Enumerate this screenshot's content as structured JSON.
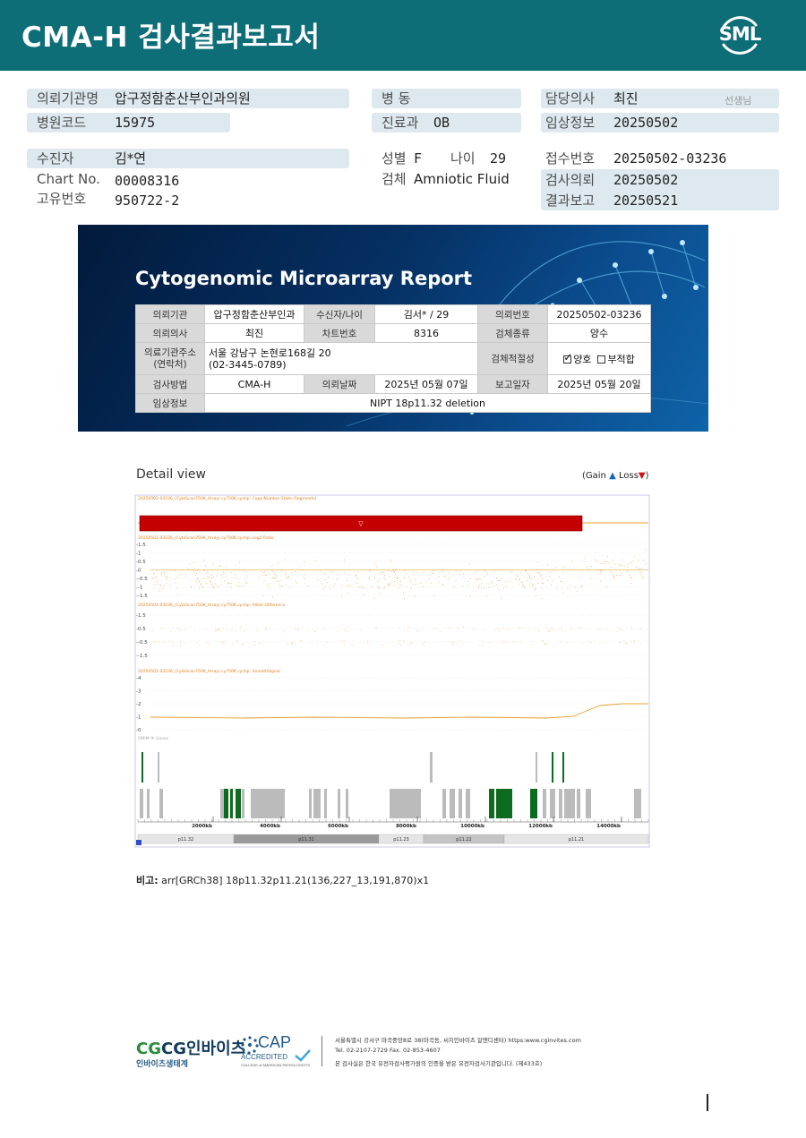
{
  "header": {
    "title": "CMA-H 검사결과보고서",
    "logo_text": "SML"
  },
  "info": {
    "institution_label": "의뢰기관명",
    "institution": "압구정함춘산부인과의원",
    "hospital_code_label": "병원코드",
    "hospital_code": "15975",
    "patient_label": "수진자",
    "patient": "김*연",
    "chart_no_label": "Chart No.",
    "chart_no": "00008316",
    "unique_no_label": "고유번호",
    "unique_no": "950722-2",
    "ward_label": "병 동",
    "dept_label": "진료과",
    "dept": "OB",
    "sex_label": "성별",
    "sex": "F",
    "age_label": "나이",
    "age": "29",
    "specimen_label": "검체",
    "specimen": "Amniotic Fluid",
    "doctor_label": "담당의사",
    "doctor": "최진",
    "doctor_suffix": "선생님",
    "clinical_label": "임상정보",
    "clinical": "20250502",
    "receipt_label": "접수번호",
    "receipt": "20250502-03236",
    "request_label": "검사의뢰",
    "request": "20250502",
    "report_label": "결과보고",
    "report": "20250521"
  },
  "banner": {
    "title": "Cytogenomic Microarray Report",
    "table": {
      "inst_label": "의뢰기관",
      "inst": "압구정함춘산부인과",
      "recipient_label": "수신자/나이",
      "recipient": "김서* / 29",
      "req_no_label": "의뢰번호",
      "req_no": "20250502-03236",
      "doctor_label": "의뢰의사",
      "doctor": "최진",
      "chart_label": "차트번호",
      "chart": "8316",
      "spec_label": "검체종류",
      "spec": "양수",
      "addr_label_1": "의료기관주소",
      "addr_label_2": "(연락처)",
      "addr_1": "서울 강남구 논현로168길 20",
      "addr_2": "(02-3445-0789)",
      "adequacy_label": "검체적절성",
      "adequate": "양호",
      "inadequate": "부적합",
      "method_label": "검사방법",
      "method": "CMA-H",
      "req_date_label": "의뢰날짜",
      "req_date": "2025년 05월 07일",
      "report_date_label": "보고일자",
      "report_date": "2025년 05월 20일",
      "clinical_label": "임상정보",
      "clinical": "NIPT 18p11.32 deletion"
    }
  },
  "detail": {
    "title": "Detail view",
    "legend_prefix": "(Gain",
    "legend_gain_icon": "▲",
    "legend_mid": "Loss",
    "legend_loss_icon": "▼",
    "legend_suffix": ")",
    "track_cn": "20250502-03236_(CytoScan750K_Array).cy750K.cychp: Copy Number State (Segments)",
    "track_log2": "20250502-03236_(CytoScan750K_Array).cy750K.cychp: Log2 Ratio",
    "track_allele": "20250502-03236_(CytoScan750K_Array).cy750K.cychp: Allele Difference",
    "track_smooth": "20250502-03236_(CytoScan750K_Array).cy750K.cychp: SmoothSignal",
    "track_omim": "OMIM ® Genes",
    "log2_ticks": [
      "1.5",
      "1",
      "0.5",
      "0",
      "-0.5",
      "-1",
      "-1.5"
    ],
    "allele_ticks": [
      "1.5",
      "0.5",
      "-0.5",
      "-1.5"
    ],
    "smooth_ticks": [
      "4",
      "3",
      "2",
      "1",
      "0"
    ],
    "axis_ticks": [
      "2000kb",
      "4000kb",
      "6000kb",
      "8000kb",
      "10000kb",
      "12000kb",
      "14000kb"
    ],
    "bands": [
      "p11.32",
      "p11.31",
      "p11.23",
      "p11.22",
      "p11.21"
    ],
    "loss_glyph": "▽",
    "remark_label": "비고:",
    "remark": "arr[GRCh38] 18p11.32p11.21(136,227_13,191,870)x1"
  },
  "footer": {
    "logo_main": "CG인바이츠",
    "logo_sub": "인바이츠생태계",
    "cap": "CAP",
    "cap_accredited": "ACCREDITED",
    "cap_college": "COLLEGE of AMERICAN PATHOLOGISTS",
    "addr_line1": "서울특별시 강서구 마곡중앙8로 38(마곡동, 씨지인바이츠 알앤디센터)  https:www.cginvites.com",
    "addr_line2": "Tel. 02-2107-2729   Fax. 02-853-4607",
    "addr_line3": "본 검사실은 한국 유전자검사평가원의 인증을 받은 유전자검사기관입니다. (제433호)"
  },
  "colors": {
    "header": "#0e6e78",
    "loss": "#c40000",
    "gain": "#1a5fc6",
    "signal": "#e8a030",
    "omim": "#0c6b1e"
  }
}
